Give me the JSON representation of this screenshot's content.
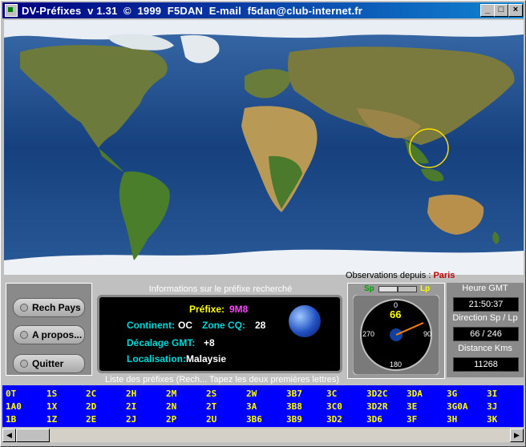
{
  "window": {
    "title": "DV-Préfixes  v 1.31  ©  1999  F5DAN  E-mail  f5dan@club-internet.fr"
  },
  "observations": {
    "label": "Observations depuis : ",
    "city": "Paris"
  },
  "buttons": {
    "search": "Rech Pays",
    "about": "A propos...",
    "quit": "Quitter"
  },
  "info": {
    "caption": "Informations sur le préfixe recherché",
    "prefix_label": "Préfixe:",
    "prefix_value": "9M8",
    "continent_label": "Continent:",
    "continent_value": "OC",
    "zone_label": "Zone CQ:",
    "zone_value": "28",
    "gmt_label": "Décalage GMT:",
    "gmt_value": "+8",
    "loc_label": "Localisation:",
    "loc_value": "Malaysie"
  },
  "compass": {
    "sp": "Sp",
    "lp": "Lp",
    "heading": "66",
    "n": "0",
    "e": "90",
    "s": "180",
    "w": "270"
  },
  "right": {
    "gmt_label": "Heure GMT",
    "gmt_value": "21:50:37",
    "dir_label": "Direction Sp / Lp",
    "dir_value": "66 / 246",
    "dist_label": "Distance Kms",
    "dist_value": "11268"
  },
  "list": {
    "caption": "Liste des préfixes (Rech... Tapez les deux premières lettres)",
    "rows": [
      [
        "0T",
        "1S",
        "2C",
        "2H",
        "2M",
        "2S",
        "2W",
        "3B7",
        "3C",
        "3D2C",
        "3DA",
        "3G",
        "3I"
      ],
      [
        "1A0",
        "1X",
        "2D",
        "2I",
        "2N",
        "2T",
        "3A",
        "3B8",
        "3C0",
        "3D2R",
        "3E",
        "3G0A",
        "3J"
      ],
      [
        "1B",
        "1Z",
        "2E",
        "2J",
        "2P",
        "2U",
        "3B6",
        "3B9",
        "3D2",
        "3D6",
        "3F",
        "3H",
        "3K"
      ]
    ]
  },
  "colors": {
    "accent": "#000080",
    "list_bg": "#0000ff",
    "list_text": "#ffff00",
    "label": "#00d8d8",
    "prefix": "#ff40ff"
  }
}
